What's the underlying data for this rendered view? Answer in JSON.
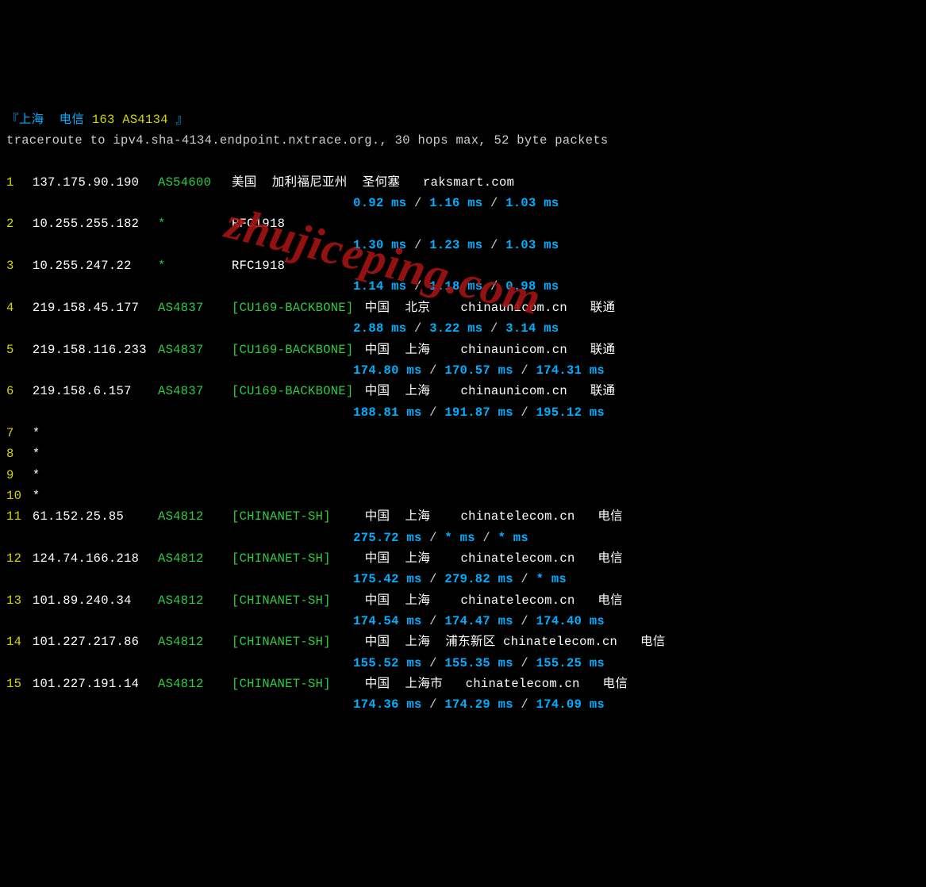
{
  "title": {
    "prefix": "『",
    "loc": "上海  电信",
    "num": "163 AS4134",
    "suffix": " 』"
  },
  "header": "traceroute to ipv4.sha-4134.endpoint.nxtrace.org., 30 hops max, 52 byte packets",
  "watermark": "zhujiceping.com",
  "hops": [
    {
      "n": "1",
      "ip": "137.175.90.190",
      "asn": "AS54600",
      "net": "",
      "loc": "美国  加利福尼亚州  圣何塞   raksmart.com",
      "rtt": [
        "0.92 ms",
        "1.16 ms",
        "1.03 ms"
      ]
    },
    {
      "n": "2",
      "ip": "10.255.255.182",
      "asn": "*",
      "net": "",
      "loc": "RFC1918",
      "rtt": [
        "1.30 ms",
        "1.23 ms",
        "1.03 ms"
      ]
    },
    {
      "n": "3",
      "ip": "10.255.247.22",
      "asn": "*",
      "net": "",
      "loc": "RFC1918",
      "rtt": [
        "1.14 ms",
        "1.18 ms",
        "0.98 ms"
      ]
    },
    {
      "n": "4",
      "ip": "219.158.45.177",
      "asn": "AS4837",
      "net": "[CU169-BACKBONE]",
      "loc": "中国  北京    chinaunicom.cn   联通",
      "rtt": [
        "2.88 ms",
        "3.22 ms",
        "3.14 ms"
      ]
    },
    {
      "n": "5",
      "ip": "219.158.116.233",
      "asn": "AS4837",
      "net": "[CU169-BACKBONE]",
      "loc": "中国  上海    chinaunicom.cn   联通",
      "rtt": [
        "174.80 ms",
        "170.57 ms",
        "174.31 ms"
      ]
    },
    {
      "n": "6",
      "ip": "219.158.6.157",
      "asn": "AS4837",
      "net": "[CU169-BACKBONE]",
      "loc": "中国  上海    chinaunicom.cn   联通",
      "rtt": [
        "188.81 ms",
        "191.87 ms",
        "195.12 ms"
      ]
    },
    {
      "n": "7",
      "ip": "*",
      "asn": "",
      "net": "",
      "loc": "",
      "rtt": []
    },
    {
      "n": "8",
      "ip": "*",
      "asn": "",
      "net": "",
      "loc": "",
      "rtt": []
    },
    {
      "n": "9",
      "ip": "*",
      "asn": "",
      "net": "",
      "loc": "",
      "rtt": []
    },
    {
      "n": "10",
      "ip": "*",
      "asn": "",
      "net": "",
      "loc": "",
      "rtt": []
    },
    {
      "n": "11",
      "ip": "61.152.25.85",
      "asn": "AS4812",
      "net": "[CHINANET-SH]",
      "loc": "中国  上海    chinatelecom.cn   电信",
      "rtt": [
        "275.72 ms",
        "* ms",
        "* ms"
      ]
    },
    {
      "n": "12",
      "ip": "124.74.166.218",
      "asn": "AS4812",
      "net": "[CHINANET-SH]",
      "loc": "中国  上海    chinatelecom.cn   电信",
      "rtt": [
        "175.42 ms",
        "279.82 ms",
        "* ms"
      ]
    },
    {
      "n": "13",
      "ip": "101.89.240.34",
      "asn": "AS4812",
      "net": "[CHINANET-SH]",
      "loc": "中国  上海    chinatelecom.cn   电信",
      "rtt": [
        "174.54 ms",
        "174.47 ms",
        "174.40 ms"
      ]
    },
    {
      "n": "14",
      "ip": "101.227.217.86",
      "asn": "AS4812",
      "net": "[CHINANET-SH]",
      "loc": "中国  上海  浦东新区 chinatelecom.cn   电信",
      "rtt": [
        "155.52 ms",
        "155.35 ms",
        "155.25 ms"
      ]
    },
    {
      "n": "15",
      "ip": "101.227.191.14",
      "asn": "AS4812",
      "net": "[CHINANET-SH]",
      "loc": "中国  上海市   chinatelecom.cn   电信",
      "rtt": [
        "174.36 ms",
        "174.29 ms",
        "174.09 ms"
      ]
    }
  ]
}
